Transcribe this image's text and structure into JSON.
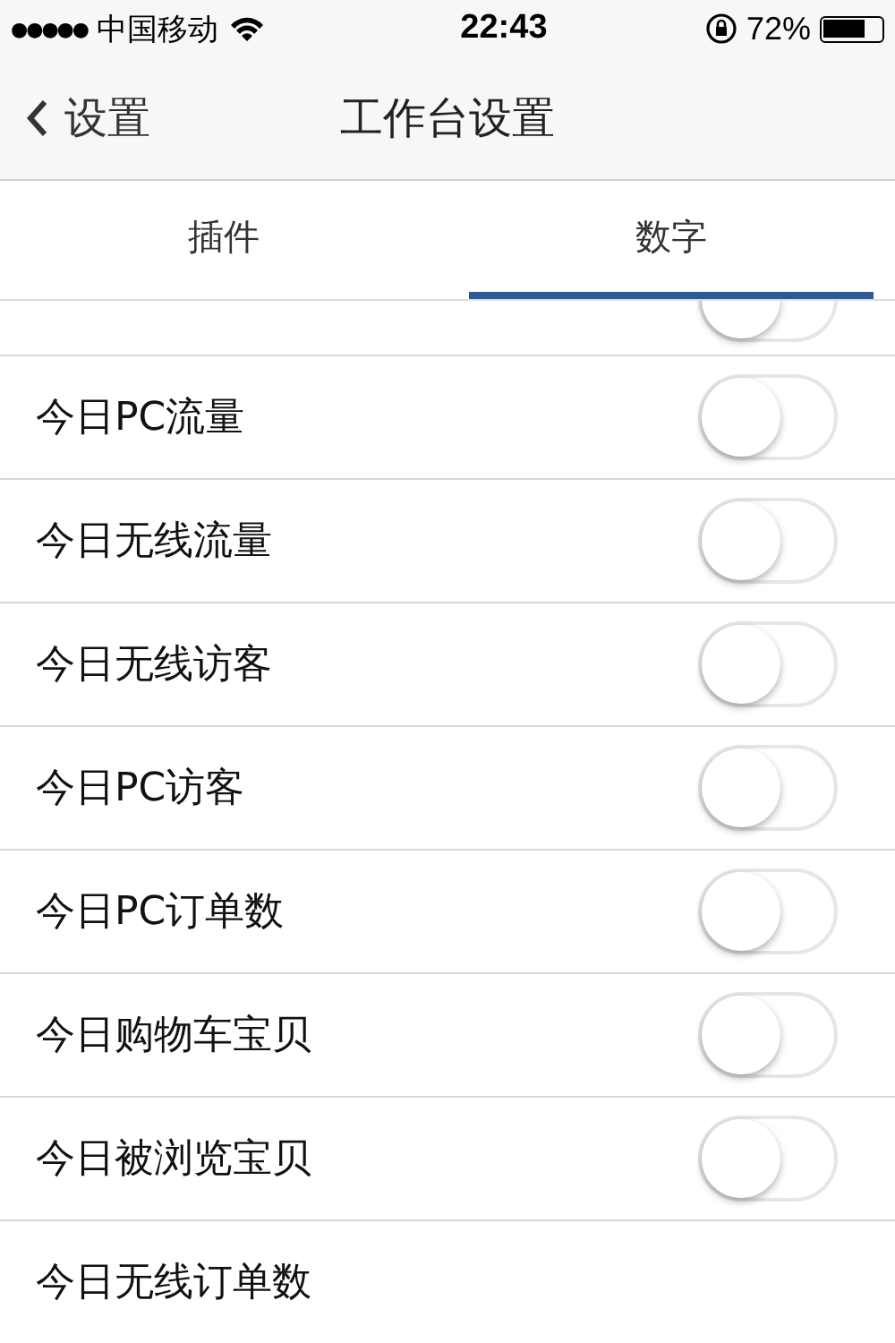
{
  "status_bar": {
    "signal": "●●●●●",
    "carrier": "中国移动",
    "time": "22:43",
    "battery": "72%"
  },
  "nav": {
    "back": "设置",
    "title": "工作台设置"
  },
  "tabs": [
    {
      "label": "插件",
      "selected": false
    },
    {
      "label": "数字",
      "selected": true
    }
  ],
  "rows": [
    {
      "kind": "cut_toggle",
      "on": false
    },
    {
      "label": "今日PC流量",
      "kind": "toggle",
      "on": false
    },
    {
      "label": "今日无线流量",
      "kind": "toggle",
      "on": false
    },
    {
      "label": "今日无线访客",
      "kind": "toggle",
      "on": false
    },
    {
      "label": "今日PC访客",
      "kind": "toggle",
      "on": false
    },
    {
      "label": "今日PC订单数",
      "kind": "toggle",
      "on": false
    },
    {
      "label": "今日购物车宝贝",
      "kind": "toggle",
      "on": false
    },
    {
      "label": "今日被浏览宝贝",
      "kind": "toggle",
      "on": false
    },
    {
      "label": "今日无线订单数",
      "kind": "plain"
    }
  ]
}
